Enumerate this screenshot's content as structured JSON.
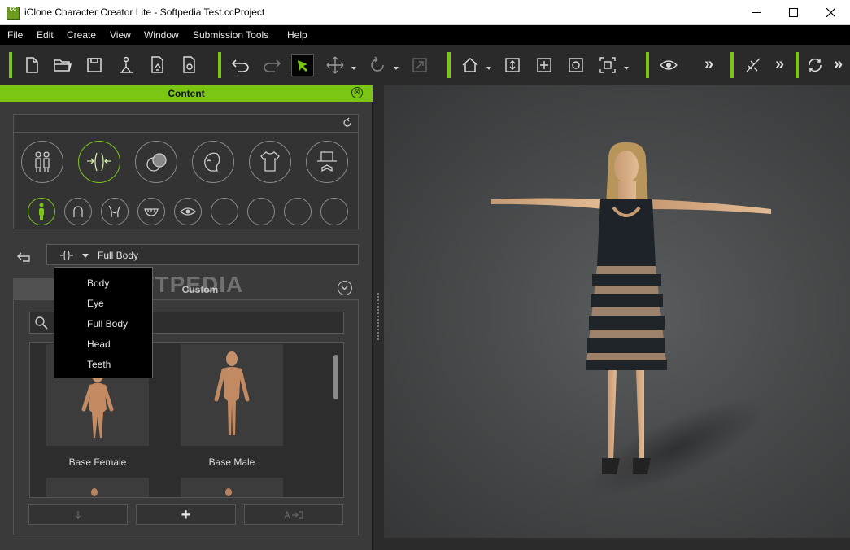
{
  "window": {
    "title": "iClone Character Creator Lite - Softpedia Test.ccProject",
    "logo_text": "CC"
  },
  "menu": [
    "File",
    "Edit",
    "Create",
    "View",
    "Window",
    "Submission Tools",
    "Help"
  ],
  "toolbar": {
    "more_glyph": "»",
    "icons": [
      "new-file-icon",
      "open-folder-icon",
      "save-icon",
      "export-icon",
      "import-icon",
      "render-icon",
      "undo-icon",
      "redo-icon",
      "select-icon",
      "move-icon",
      "rotate-icon",
      "scale-icon",
      "home-view-icon",
      "fit-height-icon",
      "fit-width-icon",
      "orbit-icon",
      "frame-icon",
      "visibility-icon",
      "pose-icon",
      "sync-icon"
    ]
  },
  "panel": {
    "title": "Content",
    "close_glyph": "⊗",
    "category_icons": [
      "characters-icon",
      "morph-icon",
      "materials-icon",
      "head-icon",
      "clothes-icon",
      "accessories-icon"
    ],
    "sub_icons": [
      "full-body-icon",
      "head-icon",
      "torso-icon",
      "teeth-icon",
      "eye-icon",
      "empty-slot-1",
      "empty-slot-2",
      "empty-slot-3",
      "empty-slot-4"
    ],
    "combo_value": "Full Body",
    "tabs": [
      "Template",
      "Custom"
    ],
    "tab_visible_label": "Te",
    "popup_items": [
      "Body",
      "Eye",
      "Full Body",
      "Head",
      "Teeth"
    ],
    "thumbnails": [
      {
        "label": "Base Female"
      },
      {
        "label": "Base Male"
      }
    ],
    "buttons": {
      "add_glyph": "+"
    }
  },
  "watermark": "SOFTPEDIA",
  "colors": {
    "accent": "#7bc614",
    "panel_bg": "#3a3a3a",
    "toolbar_bg": "#2a2a2a"
  }
}
